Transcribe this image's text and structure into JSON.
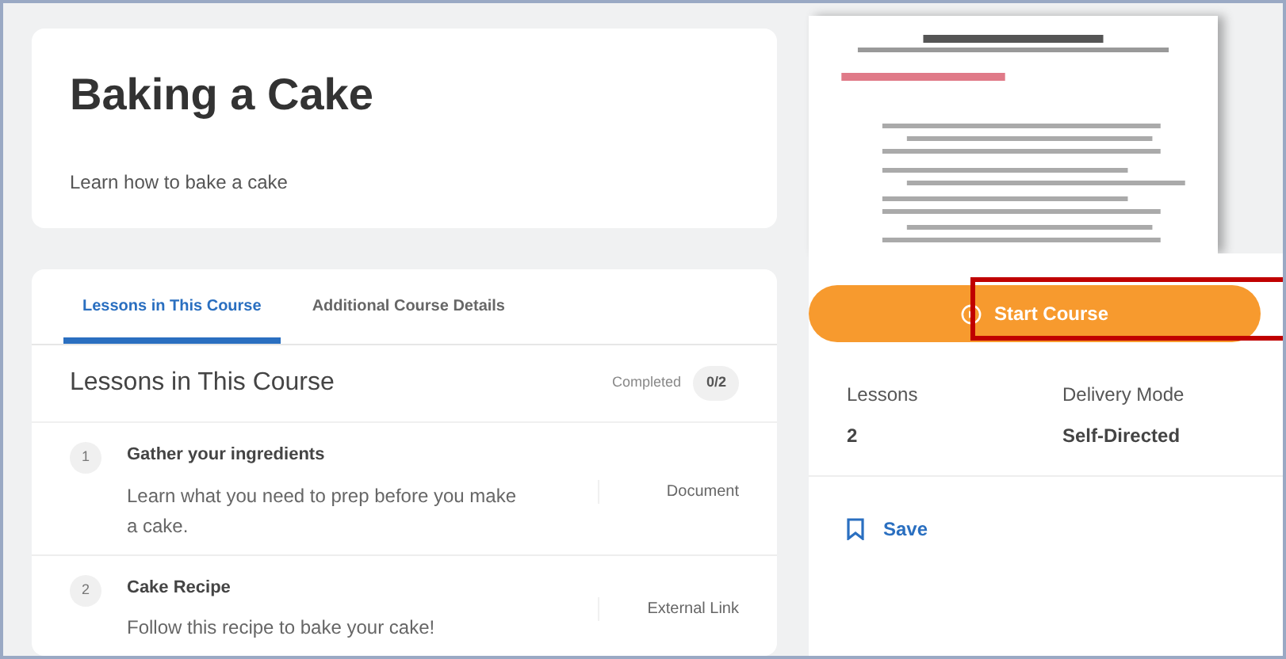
{
  "course": {
    "title": "Baking a Cake",
    "description": "Learn how to bake a cake"
  },
  "tabs": [
    {
      "label": "Lessons in This Course",
      "selected": true
    },
    {
      "label": "Additional Course Details",
      "selected": false
    }
  ],
  "lessons_panel": {
    "heading": "Lessons in This Course",
    "completed_label": "Completed",
    "completed_count": "0/2"
  },
  "lessons": [
    {
      "number": "1",
      "title": "Gather your ingredients",
      "description": "Learn what you need to prep before you make a cake.",
      "type": "Document"
    },
    {
      "number": "2",
      "title": "Cake Recipe",
      "description": "Follow this recipe to bake your cake!",
      "type": "External Link"
    }
  ],
  "start_button": {
    "label": "Start Course",
    "highlighted": true
  },
  "details": [
    {
      "label": "Lessons",
      "value": "2"
    },
    {
      "label": "Delivery Mode",
      "value": "Self-Directed"
    }
  ],
  "save_link": {
    "label": "Save"
  }
}
